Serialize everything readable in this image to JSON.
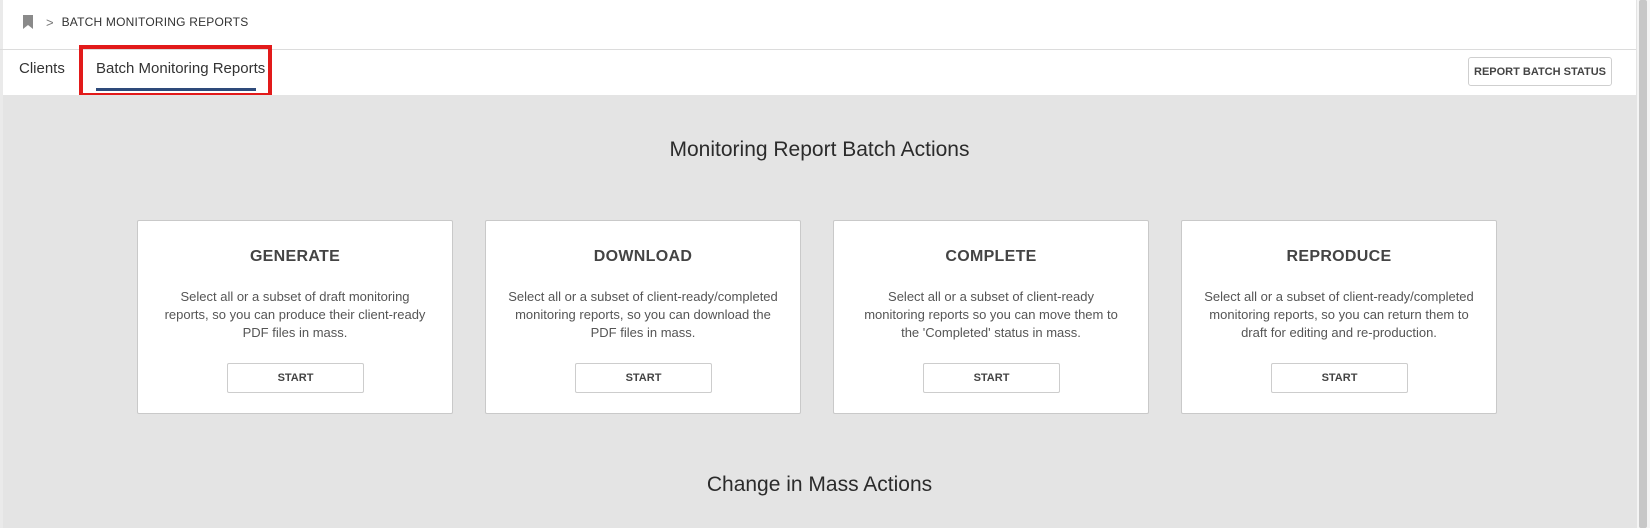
{
  "breadcrumb": {
    "icon": "bookmark-icon",
    "separator": ">",
    "current": "BATCH MONITORING REPORTS"
  },
  "tabs": [
    {
      "label": "Clients",
      "active": false
    },
    {
      "label": "Batch Monitoring Reports",
      "active": true
    }
  ],
  "toolbar": {
    "report_batch_status_label": "REPORT BATCH STATUS"
  },
  "main": {
    "batch_section_title": "Monitoring Report Batch Actions",
    "mass_section_title": "Change in Mass Actions",
    "cards": [
      {
        "title": "GENERATE",
        "description": "Select all or a subset of draft monitoring reports, so you can produce their client-ready PDF files in mass.",
        "button_label": "START"
      },
      {
        "title": "DOWNLOAD",
        "description": "Select all or a subset of client-ready/completed monitoring reports, so you can download the PDF files in mass.",
        "button_label": "START"
      },
      {
        "title": "COMPLETE",
        "description": "Select all or a subset of client-ready monitoring reports so you can move them to the 'Completed' status in mass.",
        "button_label": "START"
      },
      {
        "title": "REPRODUCE",
        "description": "Select all or a subset of client-ready/completed monitoring reports, so you can return them to draft for editing and re-production.",
        "button_label": "START"
      }
    ]
  },
  "colors": {
    "active_tab_underline": "#2e4a7a",
    "highlight_border": "#e21a1a",
    "content_background": "#e4e4e4"
  }
}
